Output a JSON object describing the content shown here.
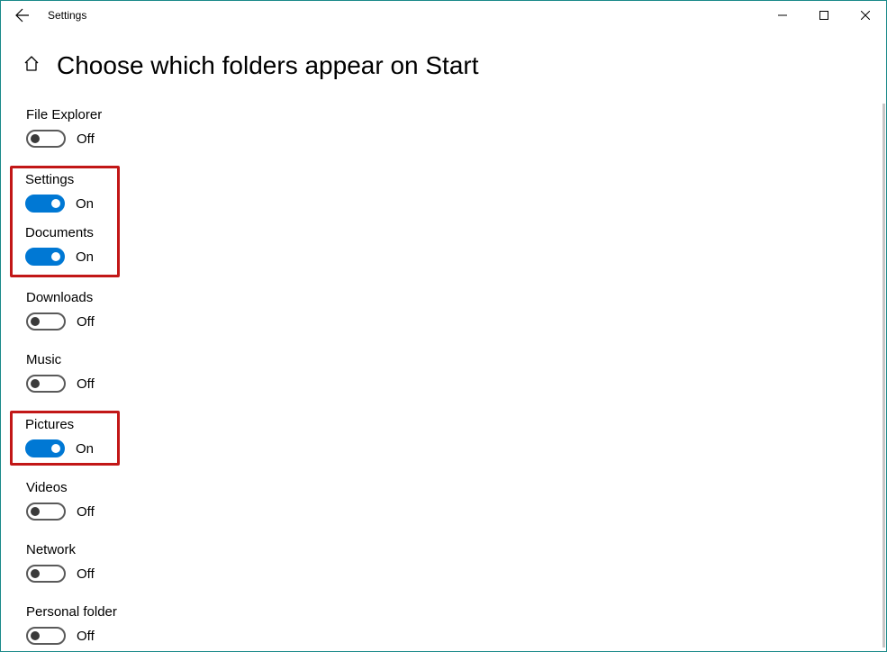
{
  "window": {
    "title": "Settings"
  },
  "page": {
    "heading": "Choose which folders appear on Start"
  },
  "labels": {
    "on": "On",
    "off": "Off"
  },
  "items": [
    {
      "name": "File Explorer",
      "state": "off",
      "highlight": false
    },
    {
      "name": "Settings",
      "state": "on",
      "highlight": true,
      "group": 1
    },
    {
      "name": "Documents",
      "state": "on",
      "highlight": true,
      "group": 1
    },
    {
      "name": "Downloads",
      "state": "off",
      "highlight": false
    },
    {
      "name": "Music",
      "state": "off",
      "highlight": false
    },
    {
      "name": "Pictures",
      "state": "on",
      "highlight": true,
      "group": 2
    },
    {
      "name": "Videos",
      "state": "off",
      "highlight": false
    },
    {
      "name": "Network",
      "state": "off",
      "highlight": false
    },
    {
      "name": "Personal folder",
      "state": "off",
      "highlight": false
    }
  ]
}
